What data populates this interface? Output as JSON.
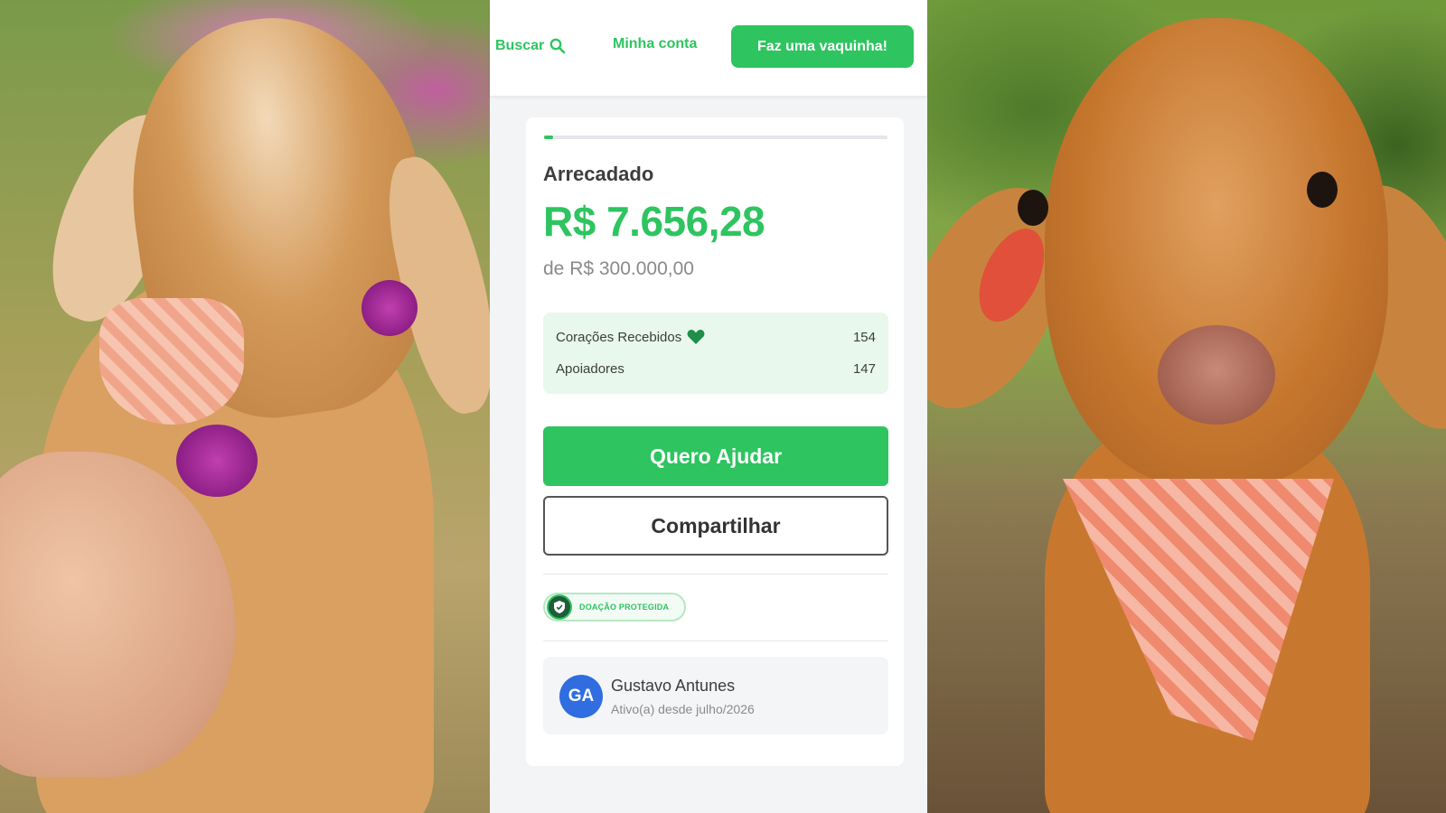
{
  "header": {
    "search_label": "Buscar",
    "account_label": "Minha conta",
    "cta_label": "Faz uma vaquinha!"
  },
  "campaign": {
    "progress_percent": 2.55,
    "raised_label": "Arrecadado",
    "raised_value": "R$ 7.656,28",
    "goal_text": "de R$ 300.000,00"
  },
  "stats": {
    "hearts_label": "Corações Recebidos",
    "hearts_value": "154",
    "supporters_label": "Apoiadores",
    "supporters_value": "147"
  },
  "actions": {
    "help_label": "Quero Ajudar",
    "share_label": "Compartilhar"
  },
  "badge": {
    "text": "DOAÇÃO PROTEGIDA"
  },
  "organizer": {
    "initials": "GA",
    "name": "Gustavo Antunes",
    "since": "Ativo(a) desde julho/2026"
  },
  "colors": {
    "brand_green": "#2ec460",
    "avatar_blue": "#2f6de1",
    "stats_bg": "#e9f8ec"
  },
  "icons": {
    "search": "search-icon",
    "heart": "heart-icon",
    "shield": "shield-icon"
  }
}
